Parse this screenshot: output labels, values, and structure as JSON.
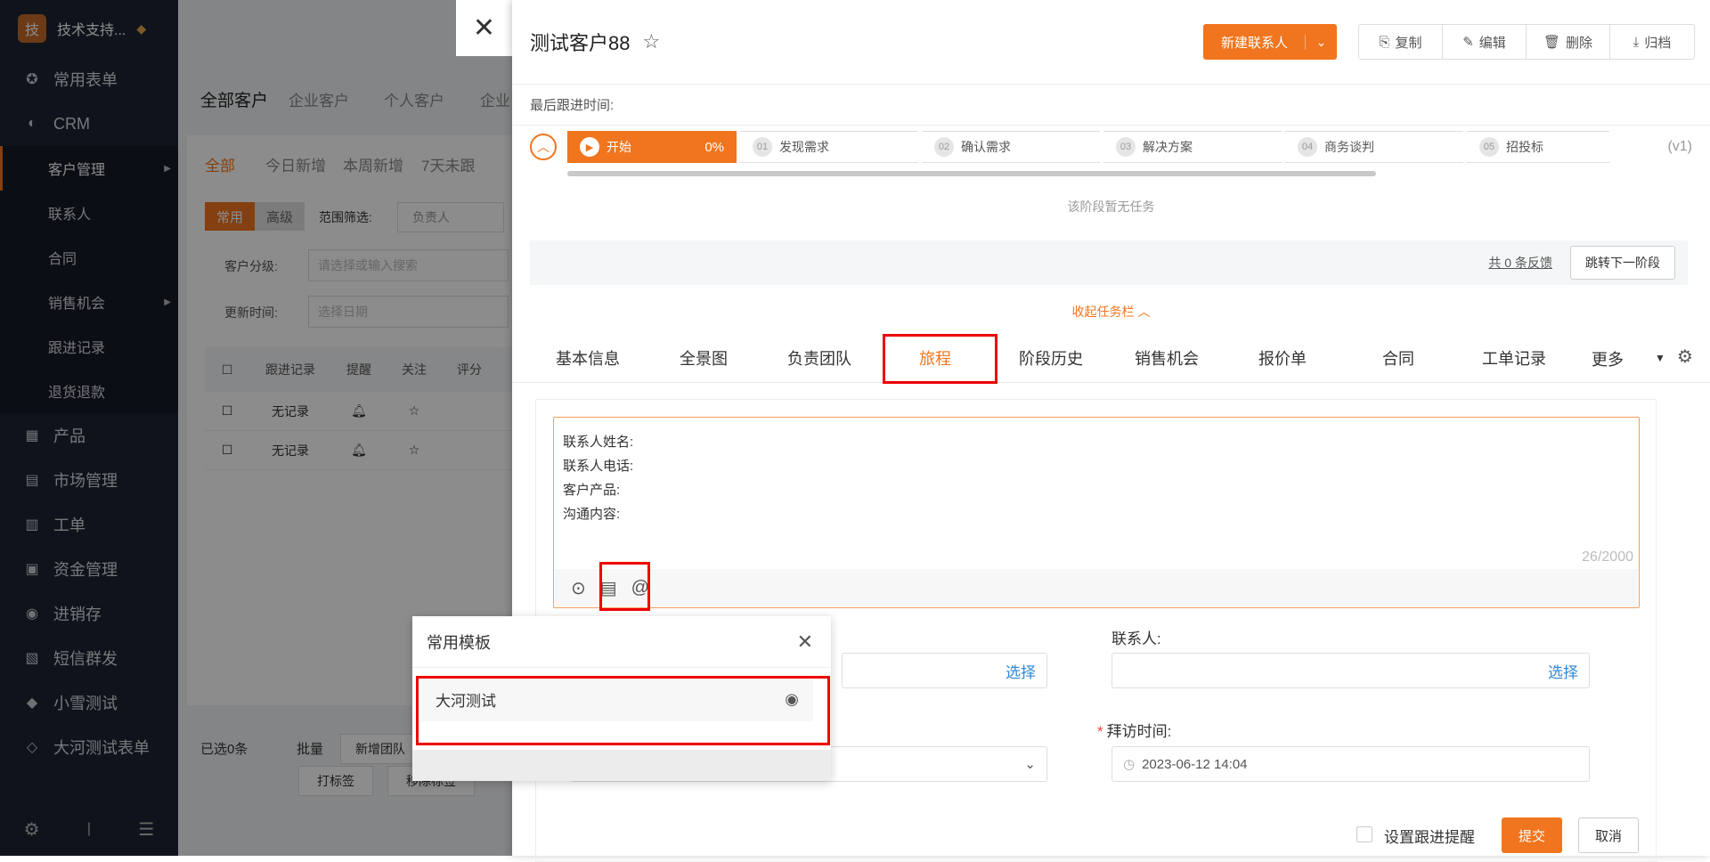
{
  "sidebar": {
    "avatar": "技",
    "user": "技术支持...",
    "items": [
      "常用表单",
      "CRM"
    ],
    "crm_sub": [
      "客户管理",
      "联系人",
      "合同",
      "销售机会",
      "跟进记录",
      "退货退款"
    ],
    "items2": [
      "产品",
      "市场管理",
      "工单",
      "资金管理",
      "进销存",
      "短信群发",
      "小雪测试",
      "大河测试表单"
    ]
  },
  "background": {
    "tabs": [
      "全部客户",
      "企业客户",
      "个人客户",
      "企业"
    ],
    "subtabs": [
      "全部",
      "今日新增",
      "本周新增",
      "7天未跟"
    ],
    "filter_modes": [
      "常用",
      "高级"
    ],
    "range_label": "范围筛选:",
    "range_value": "负责人",
    "level_label": "客户分级:",
    "level_placeholder": "请选择或输入搜索",
    "update_label": "更新时间:",
    "date_placeholder": "选择日期",
    "columns": [
      "跟进记录",
      "提醒",
      "关注",
      "评分"
    ],
    "rows": [
      "无记录",
      "无记录"
    ],
    "selected": "已选0条",
    "batch": "批量",
    "batch_actions": [
      "新增团队",
      "打标签",
      "移除标签"
    ]
  },
  "drawer": {
    "title": "测试客户88",
    "new_contact": "新建联系人",
    "actions": [
      "复制",
      "编辑",
      "删除",
      "归档"
    ],
    "last_follow": "最后跟进时间:",
    "stages": [
      {
        "num": "",
        "label": "开始",
        "pct": "0%"
      },
      {
        "num": "01",
        "label": "发现需求"
      },
      {
        "num": "02",
        "label": "确认需求"
      },
      {
        "num": "03",
        "label": "解决方案"
      },
      {
        "num": "04",
        "label": "商务谈判"
      },
      {
        "num": "05",
        "label": "招投标"
      }
    ],
    "version": "(v1)",
    "no_task": "该阶段暂无任务",
    "feedback": "共 0 条反馈",
    "next_stage": "跳转下一阶段",
    "collapse": "收起任务栏",
    "tabs": [
      "基本信息",
      "全景图",
      "负责团队",
      "旅程",
      "阶段历史",
      "销售机会",
      "报价单",
      "合同",
      "工单记录"
    ],
    "more": "更多",
    "editor_lines": [
      "联系人姓名:",
      "联系人电话:",
      "客户产品:",
      "沟通内容:"
    ],
    "editor_count": "26/2000",
    "contact_label": "联系人:",
    "select": "选择",
    "visit_label": "拜访时间:",
    "visit_value": "2023-06-12 14:04",
    "reminder": "设置跟进提醒",
    "submit": "提交",
    "cancel": "取消"
  },
  "popup": {
    "title": "常用模板",
    "item": "大河测试"
  }
}
